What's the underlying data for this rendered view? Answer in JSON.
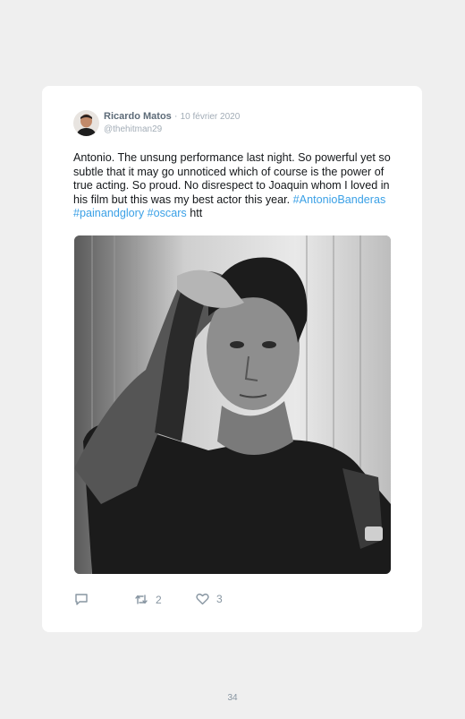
{
  "tweet": {
    "author_name": "Ricardo Matos",
    "separator": " · ",
    "date": "10 février 2020",
    "handle": "@thehitman29",
    "text": "Antonio. The unsung performance last night. So powerful yet so subtle that it may go unnoticed which of course is the power of true acting. So proud. No disrespect to Joaquin whom I loved in his film but this was my best actor this year. ",
    "hashtags": [
      "#AntonioBanderas",
      "#painandglory",
      "#oscars"
    ],
    "text_tail": "htt",
    "photo_icon": "black-and-white-portrait-photo",
    "actions": {
      "reply_icon": "reply-icon",
      "retweet_icon": "retweet-icon",
      "retweet_count": "2",
      "like_icon": "heart-icon",
      "like_count": "3"
    }
  },
  "page": {
    "number": "34"
  },
  "colors": {
    "background": "#efefef",
    "card": "#ffffff",
    "hashtag": "#3aa0e6",
    "muted": "#a3adb7",
    "author": "#5d6b78"
  }
}
